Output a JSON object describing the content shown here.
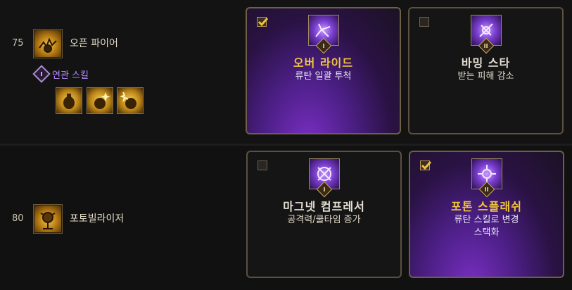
{
  "rows": [
    {
      "level": "75",
      "skill_name": "오픈 파이어",
      "skill_icon": "open-fire-skill-icon",
      "related_label": "연관 스킬",
      "related_tier": "I",
      "related_icons": [
        "grenade-icon",
        "grenade-spark-icon",
        "grenade-burst-icon"
      ],
      "tripods": [
        {
          "title": "오버 라이드",
          "desc": [
            "류탄 일괄 투척"
          ],
          "tier": "I",
          "selected": true,
          "icon": "override-tripod-icon"
        },
        {
          "title": "바밍 스타",
          "desc": [
            "받는 피해 감소"
          ],
          "tier": "II",
          "selected": false,
          "icon": "bombing-star-tripod-icon"
        }
      ]
    },
    {
      "level": "80",
      "skill_name": "포토빌라이저",
      "skill_icon": "photobilizer-skill-icon",
      "tripods": [
        {
          "title": "마그넷 컴프레서",
          "desc": [
            "공격력/쿨타임 증가"
          ],
          "tier": "I",
          "selected": false,
          "icon": "magnet-compressor-tripod-icon"
        },
        {
          "title": "포톤 스플래쉬",
          "desc": [
            "류탄 스킬로 변경",
            "스택화"
          ],
          "tier": "II",
          "selected": true,
          "icon": "photon-splash-tripod-icon"
        }
      ]
    }
  ],
  "colors": {
    "selected_title": "#f2c53d",
    "related_label": "#b68cff",
    "card_border": "#5b5041"
  }
}
